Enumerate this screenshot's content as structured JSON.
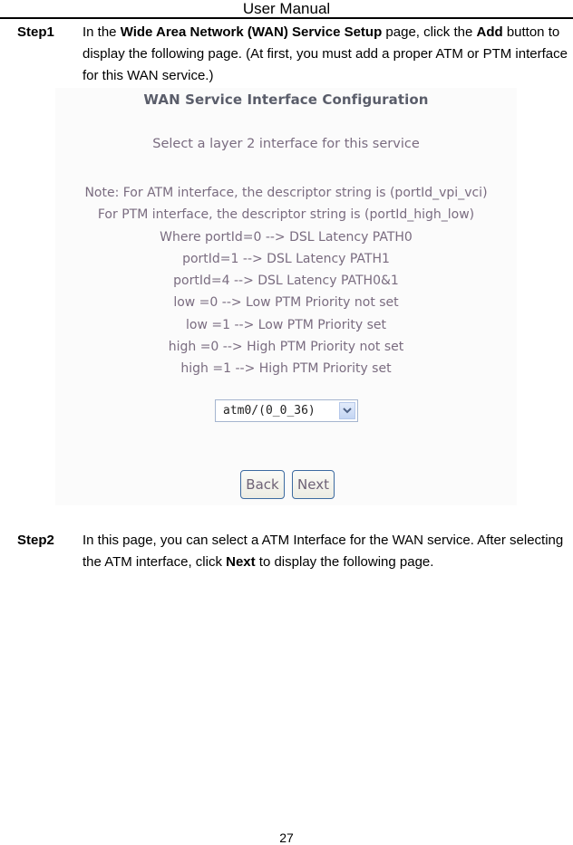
{
  "header": {
    "title": "User Manual"
  },
  "step1": {
    "label": "Step1",
    "text_parts": {
      "p1": "In the ",
      "b1": "Wide Area Network (WAN) Service Setup",
      "p2": " page, click the ",
      "b2": "Add",
      "p3": " button to display the following page. (At first, you must add a proper ATM or PTM interface for this WAN service.)"
    }
  },
  "screenshot": {
    "title": "WAN Service Interface Configuration",
    "subtitle": "Select a layer 2 interface for this service",
    "notes": [
      "Note: For ATM interface, the descriptor string is (portId_vpi_vci)",
      "For PTM interface, the descriptor string is (portId_high_low)",
      "Where portId=0 --> DSL Latency PATH0",
      "portId=1 --> DSL Latency PATH1",
      "portId=4 --> DSL Latency PATH0&1",
      "low =0 --> Low PTM Priority not set",
      "low =1 --> Low PTM Priority set",
      "high =0 --> High PTM Priority not set",
      "high =1 --> High PTM Priority set"
    ],
    "interface_select": {
      "selected": "atm0/(0_0_36)",
      "icon": "chevron-down-icon"
    },
    "buttons": {
      "back": "Back",
      "next": "Next"
    }
  },
  "step2": {
    "label": "Step2",
    "text_parts": {
      "p1": "In this page, you can select a ATM Interface for the WAN service. After selecting the ATM interface, click ",
      "b1": "Next",
      "p2": " to display the following page."
    }
  },
  "footer": {
    "page_number": "27"
  }
}
